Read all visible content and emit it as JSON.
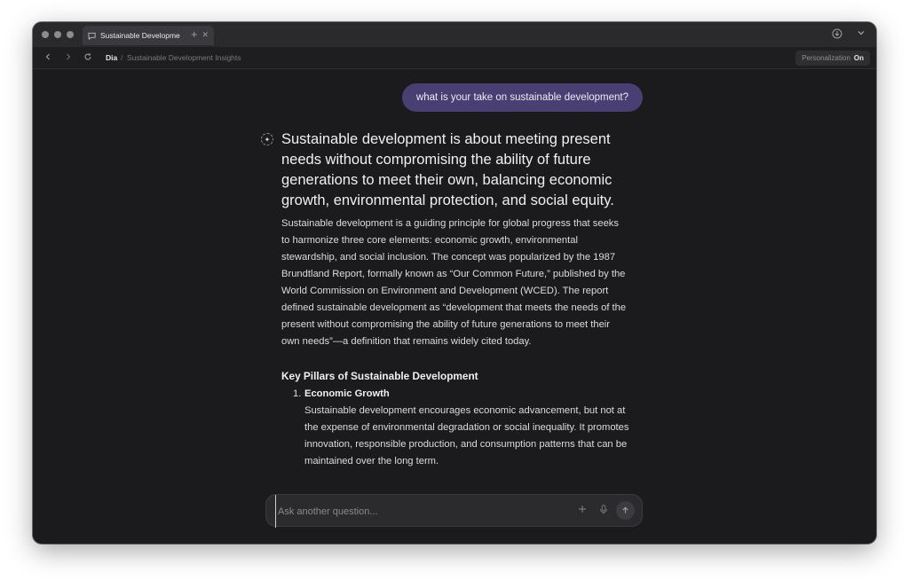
{
  "browser": {
    "tab": {
      "title": "Sustainable Developme",
      "close_icon": "close-icon"
    },
    "new_tab_label": "+",
    "breadcrumb": {
      "root": "Dia",
      "separator": "/",
      "page": "Sustainable Development Insights"
    },
    "personalization": {
      "label": "Personalization",
      "state": "On"
    }
  },
  "chat": {
    "user_message": "what is your take on sustainable development?",
    "answer": {
      "headline": "Sustainable development is about meeting present needs without compromising the ability of future generations to meet their own, balancing economic growth, environmental protection, and social equity.",
      "paragraph": "Sustainable development is a guiding principle for global progress that seeks to harmonize three core elements: economic growth, environmental stewardship, and social inclusion. The concept was popularized by the 1987 Brundtland Report, formally known as “Our Common Future,” published by the World Commission on Environment and Development (WCED). The report defined sustainable development as “development that meets the needs of the present without compromising the ability of future generations to meet their own needs”—a definition that remains widely cited today.",
      "section_title": "Key Pillars of Sustainable Development",
      "list": [
        {
          "number": "1.",
          "title": "Economic Growth",
          "body": "Sustainable development encourages economic advancement, but not at the expense of environmental degradation or social inequality. It promotes innovation, responsible production, and consumption patterns that can be maintained over the long term."
        }
      ]
    },
    "input": {
      "placeholder": "Ask another question...",
      "value": ""
    }
  },
  "icons": {
    "spark": "sparkle-icon",
    "add": "plus-icon",
    "mic": "microphone-icon",
    "send": "arrow-up-icon"
  }
}
